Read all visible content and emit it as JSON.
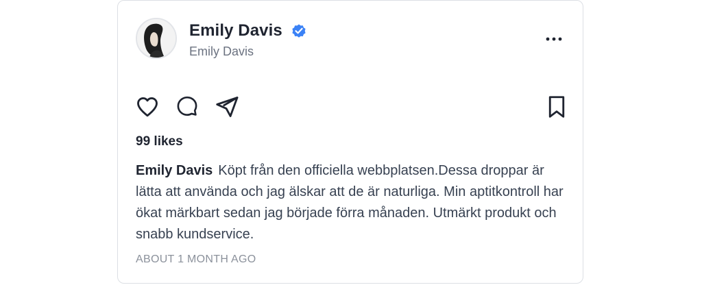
{
  "post": {
    "author_name": "Emily Davis",
    "author_handle": "Emily Davis",
    "verified": true,
    "likes_text": "99 likes",
    "caption_author": "Emily Davis",
    "caption_text": "Köpt från den officiella webbplatsen.Dessa droppar är lätta att använda och jag älskar att de är naturliga. Min aptitkontroll har ökat märkbart sedan jag började förra månaden. Utmärkt produkt och snabb kundservice.",
    "timestamp": "ABOUT 1 MONTH AGO"
  },
  "icons": {
    "verified": "verified-check-icon",
    "more": "more-horizontal-icon",
    "like": "heart-icon",
    "comment": "comment-bubble-icon",
    "share": "paper-plane-icon",
    "save": "bookmark-icon"
  },
  "colors": {
    "verified_blue": "#3b82f6",
    "icon_stroke": "#1f2430",
    "muted_text": "#6b7280"
  }
}
